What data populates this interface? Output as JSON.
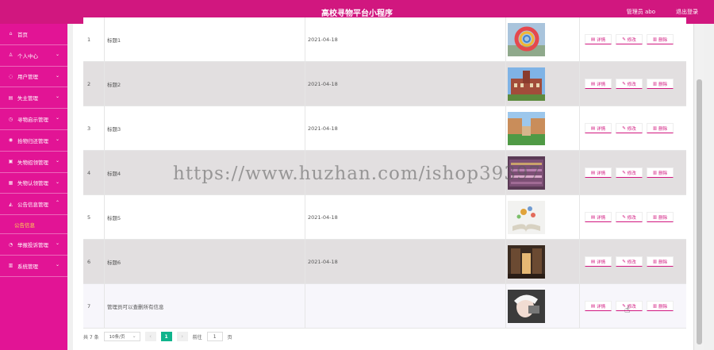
{
  "header": {
    "title": "高校寻物平台小程序",
    "user": "管理员 abo",
    "logout": "退出登录",
    "bg_color": "#d1177f"
  },
  "sidebar": {
    "bg_color": "#e21495",
    "items": [
      {
        "label": "首页",
        "icon": "home-icon",
        "chevron": false
      },
      {
        "label": "个人中心",
        "icon": "person-icon",
        "chevron": true
      },
      {
        "label": "用户管理",
        "icon": "user-icon",
        "chevron": true
      },
      {
        "label": "失主管理",
        "icon": "document-icon",
        "chevron": true
      },
      {
        "label": "寻物启示管理",
        "icon": "clock-icon",
        "chevron": true
      },
      {
        "label": "拾物归还管理",
        "icon": "location-icon",
        "chevron": true
      },
      {
        "label": "失物招领管理",
        "icon": "briefcase-icon",
        "chevron": true
      },
      {
        "label": "失物认领管理",
        "icon": "grid-icon",
        "chevron": true
      },
      {
        "label": "公告信息管理",
        "icon": "megaphone-icon",
        "chevron": true,
        "expanded": true
      },
      {
        "label": "举报投诉管理",
        "icon": "warning-icon",
        "chevron": true
      },
      {
        "label": "系统管理",
        "icon": "settings-icon",
        "chevron": true
      }
    ],
    "subitem": "公告信息",
    "subitem_color": "#ffd54f"
  },
  "table": {
    "rows": [
      {
        "index": "1",
        "title": "标题1",
        "date": "2021-04-18",
        "image": "colorful-sculpture"
      },
      {
        "index": "2",
        "title": "标题2",
        "date": "2021-04-18",
        "image": "campus-building"
      },
      {
        "index": "3",
        "title": "标题3",
        "date": "2021-04-18",
        "image": "campus-courtyard"
      },
      {
        "index": "4",
        "title": "标题4",
        "date": "",
        "image": "library-shelves"
      },
      {
        "index": "5",
        "title": "标题5",
        "date": "2021-04-18",
        "image": "open-book"
      },
      {
        "index": "6",
        "title": "标题6",
        "date": "2021-04-18",
        "image": "library-corridor"
      },
      {
        "index": "7",
        "title": "管理员可以查删所有信息",
        "date": "",
        "image": "portrait-photo"
      }
    ],
    "actions": {
      "detail": "详情",
      "edit": "修改",
      "delete": "删除"
    },
    "action_color": "#d1177f"
  },
  "pagination": {
    "total": "共 7 条",
    "page_size": "10条/页",
    "current_page": "1",
    "goto_label": "前往",
    "goto_value": "1",
    "page_unit": "页",
    "active_color": "#0fb48c"
  },
  "watermark": "https://www.huzhan.com/ishop39397"
}
